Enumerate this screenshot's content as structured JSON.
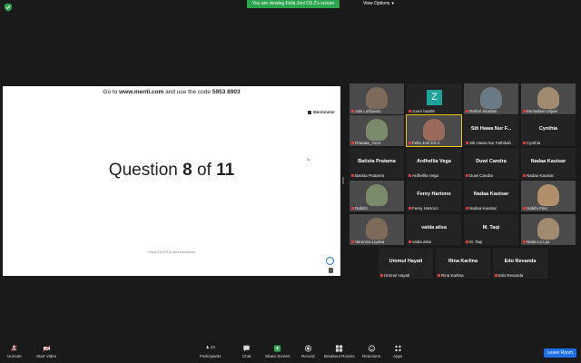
{
  "banner": {
    "viewing": "You are viewing Fella Joni DS.2's screen",
    "view_options": "View Options"
  },
  "slide": {
    "menti_prefix": "Go to ",
    "menti_site": "www.menti.com",
    "menti_mid": " and use the code ",
    "menti_code": "5953 8903",
    "logo": "Mentimeter",
    "q_prefix": "Question ",
    "q_num": "8",
    "q_mid": " of ",
    "q_total": "11",
    "press": "Press ENTER to start countdown"
  },
  "participants": [
    {
      "label": "Ade Lutfiyanto",
      "big": "",
      "video": true
    },
    {
      "label": "zoom baa06",
      "big": "",
      "video": false,
      "avatar": "Z"
    },
    {
      "label": "Rahmi Sitadian",
      "big": "",
      "video": true
    },
    {
      "label": "Esmadani Urijani",
      "big": "",
      "video": true
    },
    {
      "label": "Pranata_Yono",
      "big": "",
      "video": true
    },
    {
      "label": "Fella Joni DS.2",
      "big": "",
      "video": true,
      "active": true
    },
    {
      "label": "Siti Hawa Nur Fathikah",
      "big": "Siti Hawa Nur F...",
      "video": false
    },
    {
      "label": "Cynthia",
      "big": "Cynthia",
      "video": false
    },
    {
      "label": "Batista Pratama",
      "big": "Batista Pratama",
      "video": false
    },
    {
      "label": "Ardhellia Vega",
      "big": "Ardhellia Vega",
      "video": false
    },
    {
      "label": "Duwi Candra",
      "big": "Duwi Candra",
      "video": false
    },
    {
      "label": "Nadaa Kautsar",
      "big": "Nadaa Kautsar",
      "video": false
    },
    {
      "label": "Rafidzi",
      "big": "",
      "video": true
    },
    {
      "label": "Ferey Hartono",
      "big": "Ferey Hartono",
      "video": false
    },
    {
      "label": "Nadaa Kautsar",
      "big": "Nadaa Kautsar",
      "video": false
    },
    {
      "label": "Habibi Pasi",
      "big": "",
      "video": true
    },
    {
      "label": "Veronica Liyana",
      "big": "",
      "video": true
    },
    {
      "label": "valda ailsa",
      "big": "valda ailsa",
      "video": false
    },
    {
      "label": "M. Taqi",
      "big": "M. Taqi",
      "video": false
    },
    {
      "label": "Nada Lu Lya",
      "big": "",
      "video": true
    },
    {
      "label": "Ummul Hayati",
      "big": "Ummul Hayati",
      "video": false
    },
    {
      "label": "Rina Karlina",
      "big": "Rina Karlina",
      "video": false
    },
    {
      "label": "Edo Revanda",
      "big": "Edo Revanda",
      "video": false
    }
  ],
  "toolbar": {
    "unmute": "Unmute",
    "start_video": "Start Video",
    "participants": "Participants",
    "participants_count": "23",
    "chat": "Chat",
    "share": "Share Screen",
    "record": "Record",
    "breakout": "Breakout Rooms",
    "reactions": "Reactions",
    "apps": "Apps",
    "leave": "Leave Room"
  },
  "colors": {
    "share_green": "#2da44e",
    "leave_blue": "#1f6feb",
    "active_yellow": "#f5c400",
    "avatar_teal": "#1ba39c"
  }
}
